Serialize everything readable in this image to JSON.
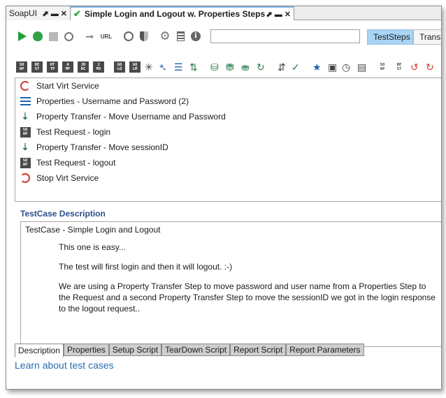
{
  "tabs": [
    {
      "label": "SoapUI",
      "controls": "⬈ ▬ ✕"
    },
    {
      "label": "Simple Login and Logout w. Properties Steps",
      "controls": "⬈ ▬ ✕"
    }
  ],
  "toolbar": {
    "search_value": "",
    "view_toggle": {
      "active": "TestSteps",
      "inactive": "Transa"
    },
    "url_label": "URL"
  },
  "step_toolbar": {
    "soap_abbr": "SO\nAP"
  },
  "steps": [
    {
      "label": "Start Virt Service",
      "icon": "virt-start-icon"
    },
    {
      "label": "Properties - Username and Password (2)",
      "icon": "properties-icon"
    },
    {
      "label": "Property Transfer - Move Username and Password",
      "icon": "property-transfer-icon"
    },
    {
      "label": "Test Request - login",
      "icon": "soap-request-icon"
    },
    {
      "label": "Property Transfer - Move sessionID",
      "icon": "property-transfer-icon"
    },
    {
      "label": "Test Request - logout",
      "icon": "soap-request-icon"
    },
    {
      "label": "Stop Virt Service",
      "icon": "virt-stop-icon"
    }
  ],
  "description": {
    "title": "TestCase Description",
    "line1": "TestCase - Simple Login and Logout",
    "para1": "This one is easy...",
    "para2": "The test will first login and then it will logout. :-)",
    "para3": "We are using a Property Transfer Step to move password and user name from a Properties Step to the Request and a second Property Transfer Step to move the sessionID we got in the login response to the logout request.."
  },
  "bottom_tabs": [
    "Description",
    "Properties",
    "Setup Script",
    "TearDown Script",
    "Report Script",
    "Report Parameters"
  ],
  "learn_link": "Learn about test cases"
}
